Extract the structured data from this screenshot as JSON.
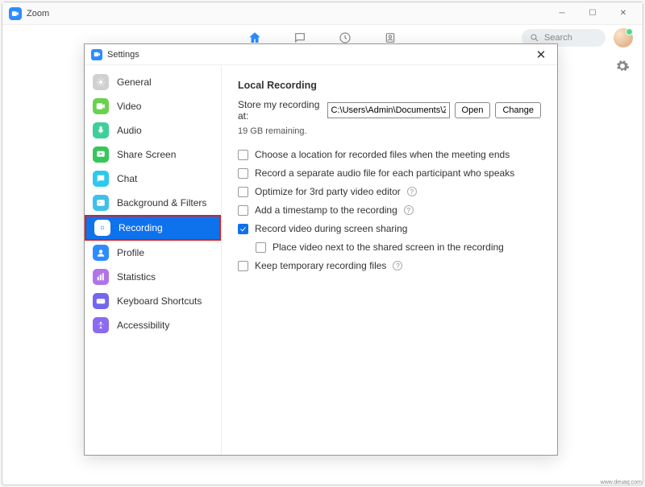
{
  "main": {
    "title": "Zoom",
    "search_label": "Search"
  },
  "settings": {
    "title": "Settings",
    "sidebar": [
      {
        "label": "General",
        "color": "#d0d0d0"
      },
      {
        "label": "Video",
        "color": "#6ad14f"
      },
      {
        "label": "Audio",
        "color": "#3dd098"
      },
      {
        "label": "Share Screen",
        "color": "#35c75a"
      },
      {
        "label": "Chat",
        "color": "#2dc8f0"
      },
      {
        "label": "Background & Filters",
        "color": "#3ec0ea"
      },
      {
        "label": "Recording",
        "color": "#0e72ed",
        "active": true
      },
      {
        "label": "Profile",
        "color": "#2d8cff"
      },
      {
        "label": "Statistics",
        "color": "#b074e8"
      },
      {
        "label": "Keyboard Shortcuts",
        "color": "#7367f0"
      },
      {
        "label": "Accessibility",
        "color": "#8b6bf0"
      }
    ],
    "content": {
      "heading": "Local Recording",
      "store_label": "Store my recording at:",
      "path_value": "C:\\Users\\Admin\\Documents\\Zoo",
      "open_btn": "Open",
      "change_btn": "Change",
      "remaining": "19 GB remaining.",
      "options": [
        {
          "label": "Choose a location for recorded files when the meeting ends",
          "checked": false
        },
        {
          "label": "Record a separate audio file for each participant who speaks",
          "checked": false
        },
        {
          "label": "Optimize for 3rd party video editor",
          "checked": false,
          "help": true
        },
        {
          "label": "Add a timestamp to the recording",
          "checked": false,
          "help": true
        },
        {
          "label": "Record video during screen sharing",
          "checked": true
        },
        {
          "label": "Place video next to the shared screen in the recording",
          "checked": false,
          "sub": true
        },
        {
          "label": "Keep temporary recording files",
          "checked": false,
          "help": true
        }
      ]
    }
  },
  "watermark": "www.deuaq.com"
}
